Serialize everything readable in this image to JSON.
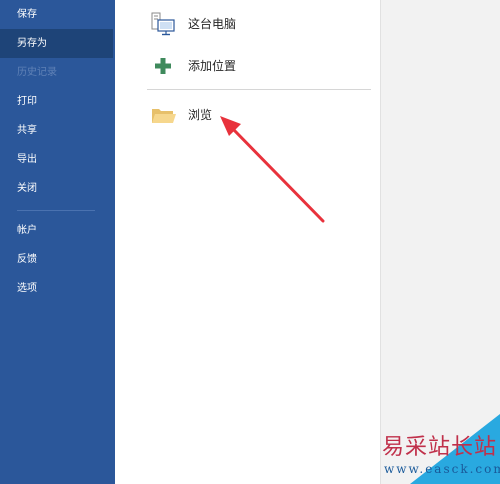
{
  "sidebar": {
    "items": [
      {
        "label": "保存"
      },
      {
        "label": "另存为"
      },
      {
        "label": "历史记录"
      },
      {
        "label": "打印"
      },
      {
        "label": "共享"
      },
      {
        "label": "导出"
      },
      {
        "label": "关闭"
      },
      {
        "label": "帐户"
      },
      {
        "label": "反馈"
      },
      {
        "label": "选项"
      }
    ],
    "active_item": "另存为",
    "disabled_item": "历史记录"
  },
  "locations": [
    {
      "label": "这台电脑",
      "icon": "computer-icon"
    },
    {
      "label": "添加位置",
      "icon": "plus-icon"
    },
    {
      "label": "浏览",
      "icon": "folder-icon"
    }
  ],
  "watermark": {
    "text": "易采站长站",
    "url": "www.easck.com"
  },
  "colors": {
    "sidebar_bg": "#2b579a",
    "active_bg": "#1e4478",
    "arrow": "#e8323c",
    "plus_green": "#3f8a5c"
  }
}
